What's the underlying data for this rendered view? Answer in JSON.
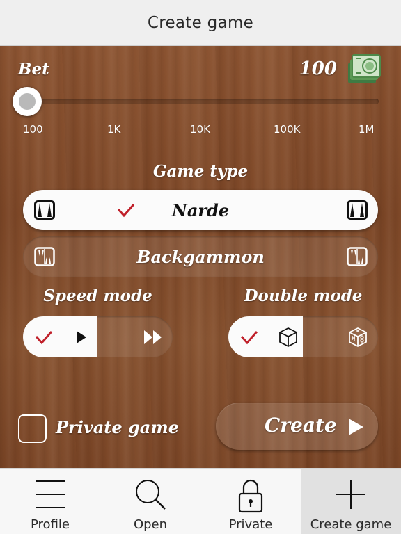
{
  "header": {
    "title": "Create game"
  },
  "bet": {
    "label": "Bet",
    "value": "100",
    "icon": "money-icon",
    "slider_position": 0,
    "ticks": [
      "100",
      "1K",
      "10K",
      "100K",
      "1M"
    ]
  },
  "game_type": {
    "title": "Game type",
    "options": [
      {
        "label": "Narde",
        "selected": true,
        "icon": "narde-board-icon"
      },
      {
        "label": "Backgammon",
        "selected": false,
        "icon": "backgammon-board-icon"
      }
    ]
  },
  "speed_mode": {
    "title": "Speed mode",
    "options": [
      {
        "icon": "play-icon",
        "selected": true
      },
      {
        "icon": "fast-forward-icon",
        "selected": false
      }
    ]
  },
  "double_mode": {
    "title": "Double mode",
    "options": [
      {
        "icon": "die-icon",
        "selected": true
      },
      {
        "icon": "doubling-cube-icon",
        "selected": false
      }
    ]
  },
  "private_game": {
    "label": "Private game",
    "checked": false
  },
  "create_button": {
    "label": "Create"
  },
  "tabs": [
    {
      "label": "Profile",
      "icon": "menu-icon",
      "active": false
    },
    {
      "label": "Open",
      "icon": "search-icon",
      "active": false
    },
    {
      "label": "Private",
      "icon": "lock-icon",
      "active": false
    },
    {
      "label": "Create game",
      "icon": "plus-icon",
      "active": true
    }
  ],
  "colors": {
    "check": "#c0202a",
    "wood": "#7d4727"
  }
}
